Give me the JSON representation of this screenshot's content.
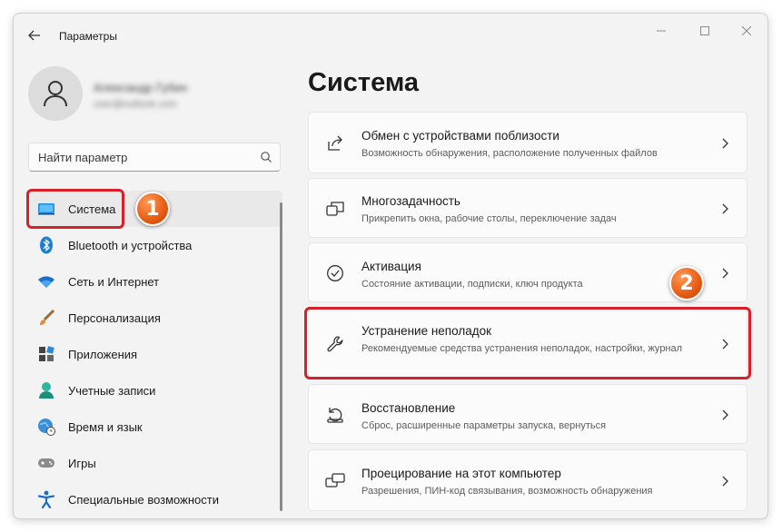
{
  "window": {
    "title": "Параметры"
  },
  "profile": {
    "name": "Александр Губин",
    "email": "user@outlook.com"
  },
  "search": {
    "placeholder": "Найти параметр"
  },
  "nav": {
    "items": [
      {
        "label": "Система",
        "icon": "system-display-icon",
        "active": true
      },
      {
        "label": "Bluetooth и устройства",
        "icon": "bluetooth-icon"
      },
      {
        "label": "Сеть и Интернет",
        "icon": "wifi-icon"
      },
      {
        "label": "Персонализация",
        "icon": "brush-icon"
      },
      {
        "label": "Приложения",
        "icon": "apps-icon"
      },
      {
        "label": "Учетные записи",
        "icon": "account-icon"
      },
      {
        "label": "Время и язык",
        "icon": "globe-clock-icon"
      },
      {
        "label": "Игры",
        "icon": "gamepad-icon"
      },
      {
        "label": "Специальные возможности",
        "icon": "accessibility-icon"
      }
    ]
  },
  "main": {
    "title": "Система",
    "cards": [
      {
        "title": "Обмен с устройствами поблизости",
        "desc": "Возможность обнаружения, расположение полученных файлов",
        "icon": "share-icon"
      },
      {
        "title": "Многозадачность",
        "desc": "Прикрепить окна, рабочие столы, переключение задач",
        "icon": "multitask-icon"
      },
      {
        "title": "Активация",
        "desc": "Состояние активации, подписки, ключ продукта",
        "icon": "check-circle-icon"
      },
      {
        "title": "Устранение неполадок",
        "desc": "Рекомендуемые средства устранения неполадок, настройки, журнал",
        "icon": "wrench-icon"
      },
      {
        "title": "Восстановление",
        "desc": "Сброс, расширенные параметры запуска, вернуться",
        "icon": "recovery-icon"
      },
      {
        "title": "Проецирование на этот компьютер",
        "desc": "Разрешения, ПИН-код связывания, возможность обнаружения",
        "icon": "project-icon"
      }
    ]
  },
  "annotations": {
    "badge1": "1",
    "badge2": "2",
    "accent_color": "#d6202a"
  }
}
